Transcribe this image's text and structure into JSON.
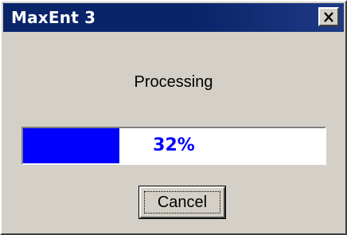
{
  "window": {
    "title": "MaxEnt 3",
    "close_icon": "close-icon"
  },
  "message": "Processing",
  "progress": {
    "percent": 32,
    "label": "32%",
    "fill_color": "#0000ff",
    "text_color": "#0000ff"
  },
  "buttons": {
    "cancel_label": "Cancel"
  },
  "colors": {
    "titlebar": "#0a246a",
    "face": "#d4d0c8"
  }
}
